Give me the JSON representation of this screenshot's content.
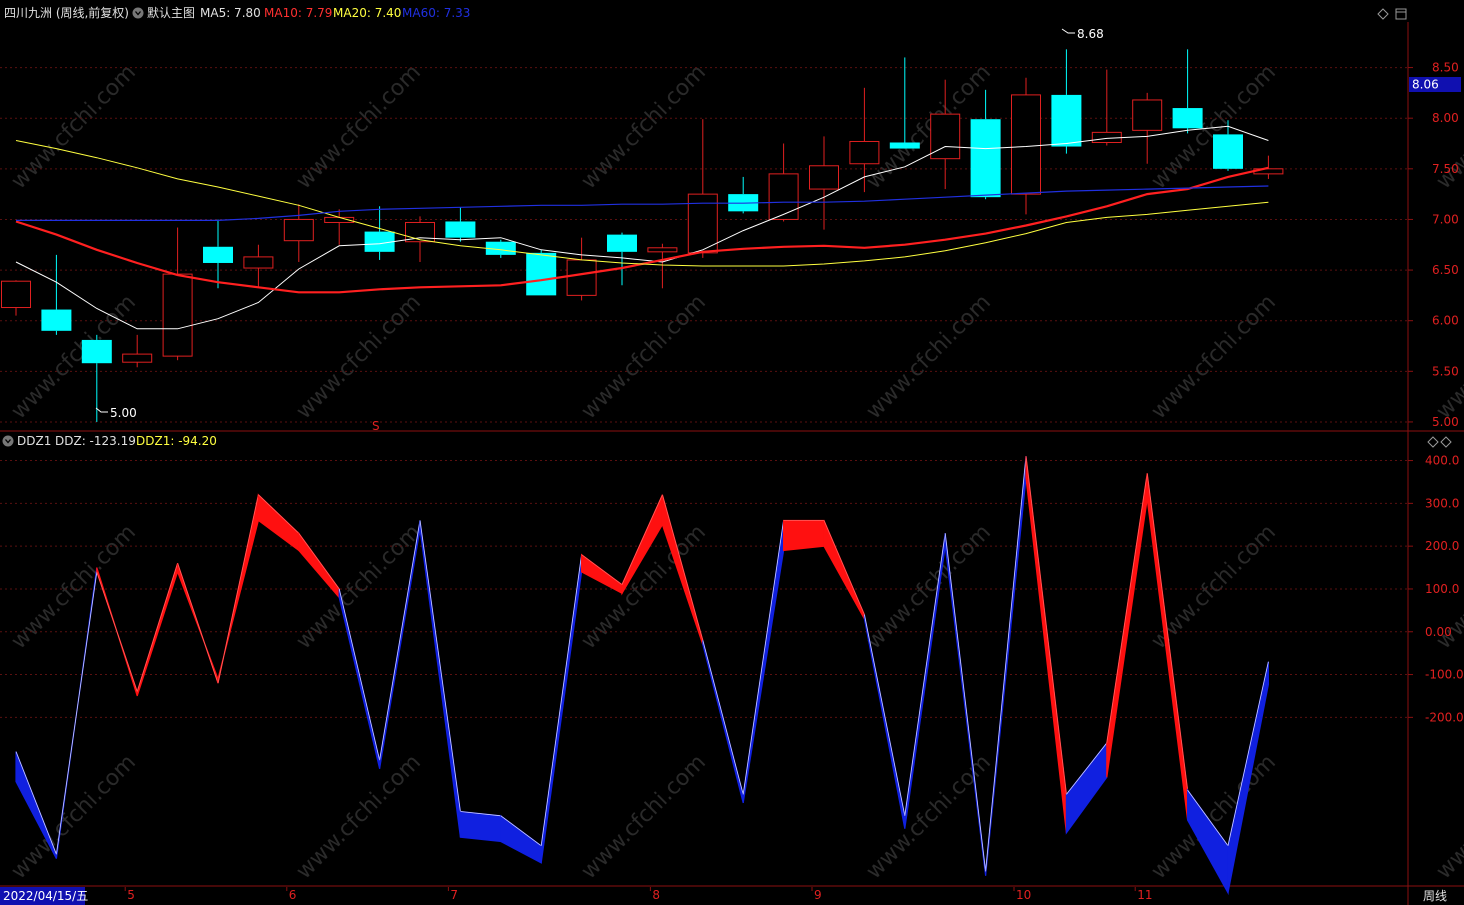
{
  "header": {
    "title": "四川九洲 (周线,前复权)",
    "layout_name": "默认主图",
    "ma5": "MA5: 7.80",
    "ma10": "MA10: 7.79",
    "ma20": "MA20: 7.40",
    "ma60": "MA60: 7.33"
  },
  "indicator_header": {
    "name": "DDZ1",
    "ddz": "DDZ: -123.19",
    "ddz1": "DDZ1: -94.20"
  },
  "footer": {
    "date": "2022/04/15/五",
    "period": "周线"
  },
  "watermark": "www.cfchi.com",
  "colors": {
    "up": "#e02020",
    "down": "#00ffff",
    "ma5": "#ffffff",
    "ma10": "#ff2020",
    "ma20": "#ffff40",
    "ma60": "#2030e0",
    "frame": "#8b1010",
    "price_tag_bg": "#1010b0"
  },
  "chart_data": [
    {
      "type": "candlestick",
      "title": "四川九洲 (周线,前复权)",
      "y_ticks": [
        "8.50",
        "8.00",
        "7.50",
        "7.00",
        "6.50",
        "6.00",
        "5.50",
        "5.00"
      ],
      "ylim": [
        4.95,
        8.95
      ],
      "current_price": "8.06",
      "annotations": {
        "max": "8.68",
        "min": "5.00",
        "marker": "S"
      },
      "x_labels": [
        "5",
        "6",
        "7",
        "8",
        "9",
        "10",
        "11"
      ],
      "x_label_index": [
        3,
        7,
        11,
        16,
        20,
        25,
        28
      ],
      "candles": [
        {
          "o": 6.13,
          "h": 6.4,
          "l": 6.05,
          "c": 6.39
        },
        {
          "o": 6.11,
          "h": 6.65,
          "l": 5.86,
          "c": 5.9
        },
        {
          "o": 5.81,
          "h": 5.86,
          "l": 5.0,
          "c": 5.58
        },
        {
          "o": 5.59,
          "h": 5.86,
          "l": 5.54,
          "c": 5.67
        },
        {
          "o": 5.65,
          "h": 6.92,
          "l": 5.61,
          "c": 6.46
        },
        {
          "o": 6.73,
          "h": 7.0,
          "l": 6.32,
          "c": 6.57
        },
        {
          "o": 6.52,
          "h": 6.75,
          "l": 6.33,
          "c": 6.63
        },
        {
          "o": 6.79,
          "h": 7.15,
          "l": 6.58,
          "c": 7.0
        },
        {
          "o": 6.97,
          "h": 7.1,
          "l": 6.75,
          "c": 7.02
        },
        {
          "o": 6.88,
          "h": 7.13,
          "l": 6.6,
          "c": 6.68
        },
        {
          "o": 6.78,
          "h": 7.03,
          "l": 6.58,
          "c": 6.97
        },
        {
          "o": 6.98,
          "h": 7.12,
          "l": 6.78,
          "c": 6.82
        },
        {
          "o": 6.78,
          "h": 6.8,
          "l": 6.62,
          "c": 6.65
        },
        {
          "o": 6.67,
          "h": 6.7,
          "l": 6.25,
          "c": 6.25
        },
        {
          "o": 6.25,
          "h": 6.82,
          "l": 6.2,
          "c": 6.6
        },
        {
          "o": 6.85,
          "h": 6.87,
          "l": 6.35,
          "c": 6.68
        },
        {
          "o": 6.68,
          "h": 6.76,
          "l": 6.32,
          "c": 6.72
        },
        {
          "o": 6.67,
          "h": 7.99,
          "l": 6.62,
          "c": 7.25
        },
        {
          "o": 7.25,
          "h": 7.42,
          "l": 7.06,
          "c": 7.08
        },
        {
          "o": 7.0,
          "h": 7.75,
          "l": 6.98,
          "c": 7.45
        },
        {
          "o": 7.3,
          "h": 7.82,
          "l": 6.9,
          "c": 7.53
        },
        {
          "o": 7.55,
          "h": 8.3,
          "l": 7.27,
          "c": 7.77
        },
        {
          "o": 7.76,
          "h": 8.6,
          "l": 7.7,
          "c": 7.7
        },
        {
          "o": 7.6,
          "h": 8.38,
          "l": 7.3,
          "c": 8.04
        },
        {
          "o": 7.99,
          "h": 8.28,
          "l": 7.2,
          "c": 7.22
        },
        {
          "o": 7.25,
          "h": 8.4,
          "l": 7.05,
          "c": 8.23
        },
        {
          "o": 8.23,
          "h": 8.68,
          "l": 7.65,
          "c": 7.72
        },
        {
          "o": 7.76,
          "h": 8.48,
          "l": 7.73,
          "c": 7.86
        },
        {
          "o": 7.88,
          "h": 8.25,
          "l": 7.55,
          "c": 8.18
        },
        {
          "o": 8.1,
          "h": 8.68,
          "l": 7.85,
          "c": 7.9
        },
        {
          "o": 7.84,
          "h": 7.98,
          "l": 7.48,
          "c": 7.5
        },
        {
          "o": 7.45,
          "h": 7.63,
          "l": 7.4,
          "c": 7.5
        }
      ],
      "series": [
        {
          "name": "MA5",
          "values": [
            6.58,
            6.38,
            6.12,
            5.92,
            5.92,
            6.02,
            6.18,
            6.51,
            6.74,
            6.76,
            6.82,
            6.8,
            6.82,
            6.7,
            6.65,
            6.62,
            6.58,
            6.7,
            6.89,
            7.05,
            7.22,
            7.42,
            7.52,
            7.72,
            7.7,
            7.72,
            7.75,
            7.8,
            7.82,
            7.88,
            7.92,
            7.78
          ]
        },
        {
          "name": "MA10",
          "values": [
            6.98,
            6.85,
            6.7,
            6.57,
            6.45,
            6.38,
            6.33,
            6.28,
            6.28,
            6.31,
            6.33,
            6.34,
            6.35,
            6.4,
            6.46,
            6.52,
            6.6,
            6.68,
            6.71,
            6.73,
            6.74,
            6.72,
            6.75,
            6.8,
            6.86,
            6.94,
            7.03,
            7.13,
            7.25,
            7.3,
            7.42,
            7.51
          ]
        },
        {
          "name": "MA20",
          "values": [
            7.78,
            7.7,
            7.61,
            7.51,
            7.4,
            7.32,
            7.23,
            7.14,
            7.02,
            6.91,
            6.8,
            6.74,
            6.7,
            6.65,
            6.6,
            6.57,
            6.55,
            6.54,
            6.54,
            6.54,
            6.56,
            6.59,
            6.63,
            6.69,
            6.77,
            6.86,
            6.97,
            7.02,
            7.05,
            7.09,
            7.13,
            7.17
          ]
        },
        {
          "name": "MA60",
          "values": [
            6.99,
            6.99,
            6.99,
            6.99,
            6.99,
            6.99,
            7.01,
            7.04,
            7.08,
            7.1,
            7.11,
            7.12,
            7.13,
            7.14,
            7.14,
            7.15,
            7.15,
            7.16,
            7.16,
            7.17,
            7.17,
            7.18,
            7.2,
            7.22,
            7.24,
            7.26,
            7.28,
            7.29,
            7.3,
            7.31,
            7.32,
            7.33
          ]
        }
      ]
    },
    {
      "type": "area",
      "title": "DDZ1",
      "y_ticks": [
        "400.0",
        "300.0",
        "200.0",
        "100.0",
        "0.00",
        "-100.0",
        "-200.0"
      ],
      "ylim": [
        -580,
        420
      ],
      "series": [
        {
          "name": "DDZ",
          "values": [
            -280,
            -520,
            140,
            -140,
            160,
            -120,
            320,
            230,
            100,
            -300,
            260,
            -420,
            -430,
            -500,
            180,
            110,
            320,
            -20,
            -380,
            260,
            260,
            40,
            -430,
            230,
            -560,
            410,
            -380,
            -260,
            370,
            -370,
            -500,
            -70
          ]
        },
        {
          "name": "DDZ1",
          "values": [
            -350,
            -530,
            150,
            -150,
            140,
            -110,
            260,
            190,
            80,
            -320,
            240,
            -480,
            -490,
            -540,
            140,
            90,
            250,
            -30,
            -400,
            190,
            200,
            30,
            -460,
            200,
            -570,
            360,
            -470,
            -340,
            310,
            -440,
            -610,
            -123
          ]
        }
      ]
    }
  ]
}
